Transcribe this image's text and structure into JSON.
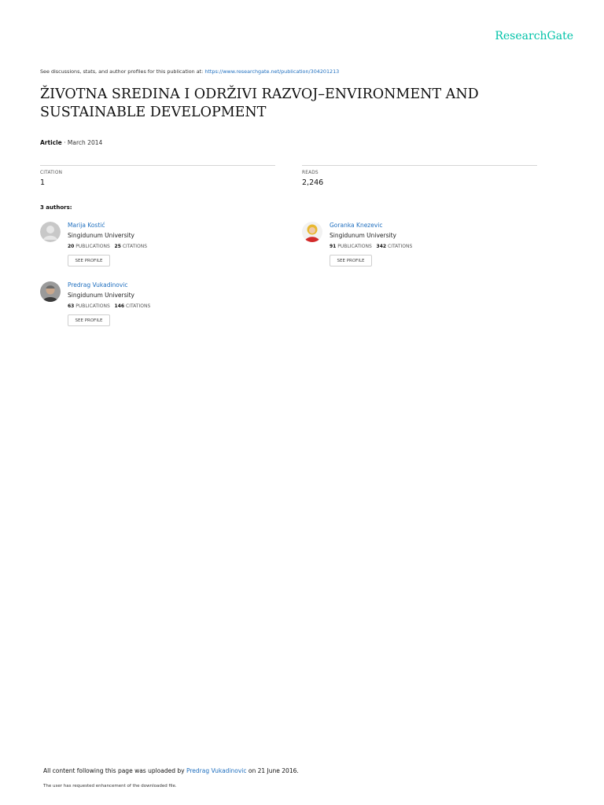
{
  "brand": "ResearchGate",
  "topline": {
    "prefix": "See discussions, stats, and author profiles for this publication at:",
    "url": "https://www.researchgate.net/publication/304201213"
  },
  "title": "ŽIVOTNA SREDINA I ODRŽIVI RAZVOJ–ENVIRONMENT AND SUSTAINABLE DEVELOPMENT",
  "meta": {
    "type": "Article",
    "date": "· March 2014"
  },
  "stats": {
    "citations_label": "CITATION",
    "citations_value": "1",
    "reads_label": "READS",
    "reads_value": "2,246"
  },
  "authors_heading": "3 authors:",
  "authors": [
    {
      "name": "Marija Kostić",
      "institution": "Singidunum University",
      "publications": "20",
      "publications_label": "PUBLICATIONS",
      "citations": "25",
      "citations_label": "CITATIONS",
      "button": "SEE PROFILE",
      "avatar": "placeholder"
    },
    {
      "name": "Goranka Knezevic",
      "institution": "Singidunum University",
      "publications": "91",
      "publications_label": "PUBLICATIONS",
      "citations": "342",
      "citations_label": "CITATIONS",
      "button": "SEE PROFILE",
      "avatar": "photo"
    },
    {
      "name": "Predrag Vukadinovic",
      "institution": "Singidunum University",
      "publications": "63",
      "publications_label": "PUBLICATIONS",
      "citations": "146",
      "citations_label": "CITATIONS",
      "button": "SEE PROFILE",
      "avatar": "photo"
    }
  ],
  "footer": {
    "uploaded_prefix": "All content following this page was uploaded by",
    "uploader": "Predrag Vukadinovic",
    "uploaded_suffix": "on 21 June 2016.",
    "note": "The user has requested enhancement of the downloaded file."
  },
  "colors": {
    "brand": "#00c2a8",
    "link": "#1f6fbf"
  }
}
